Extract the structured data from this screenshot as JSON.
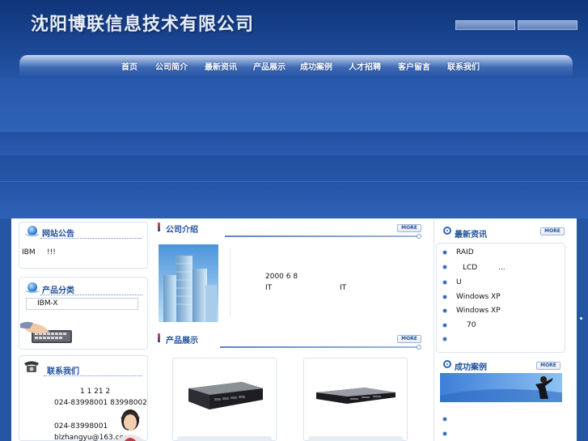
{
  "header": {
    "company_name": "沈阳博联信息技术有限公司"
  },
  "nav": {
    "items": [
      {
        "label": "首页"
      },
      {
        "label": "公司简介"
      },
      {
        "label": "最新资讯"
      },
      {
        "label": "产品展示"
      },
      {
        "label": "成功案例"
      },
      {
        "label": "人才招聘"
      },
      {
        "label": "客户留言"
      },
      {
        "label": "联系我们"
      }
    ]
  },
  "notice": {
    "title": "网站公告",
    "text_ibm": "IBM",
    "text_excl": "!!!"
  },
  "category": {
    "title": "产品分类",
    "item": "IBM-X"
  },
  "contact": {
    "title": "联系我们",
    "line1": "1 1 21 2",
    "line2": "024-83998001 83998002",
    "line3": "024-83998001",
    "line4": "blzhangyu@163.com"
  },
  "about": {
    "title": "公司介绍",
    "more": "MORE",
    "year": "2000 6 8",
    "it1": "IT",
    "it2": "IT"
  },
  "products": {
    "title": "产品展示",
    "more": "MORE"
  },
  "news": {
    "title": "最新资讯",
    "more": "MORE",
    "items": [
      "RAID",
      "LCD",
      "...",
      "U",
      "Windows XP",
      "Windows XP",
      "70",
      ""
    ]
  },
  "cases": {
    "title": "成功案例",
    "more": "MORE"
  },
  "colors": {
    "accent": "#1f4f9a",
    "header_blue": "#2456a4"
  }
}
